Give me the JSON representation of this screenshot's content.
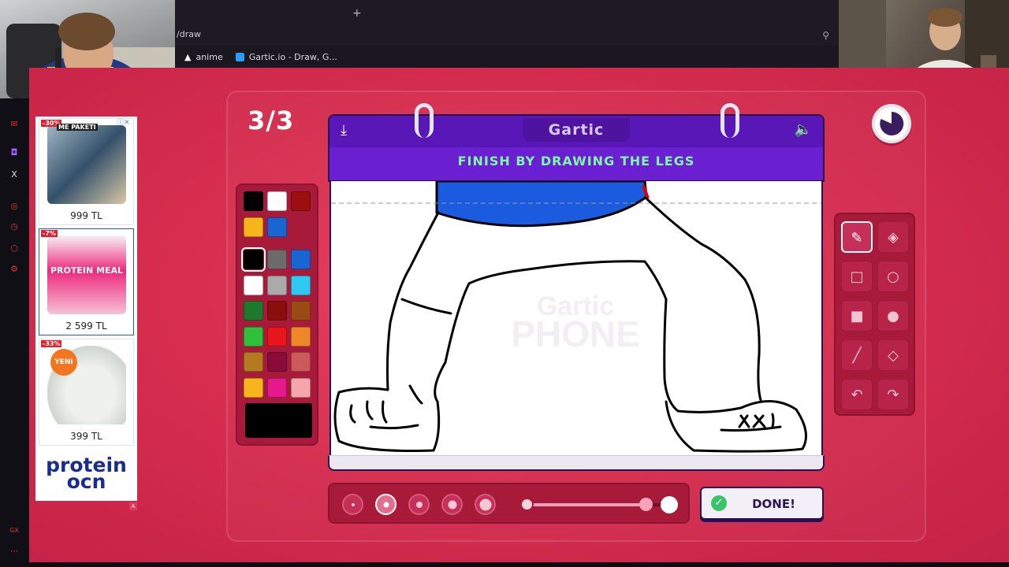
{
  "browser": {
    "new_tab": "+",
    "url_fragment": "/draw",
    "bookmarks": [
      {
        "label": "anime",
        "icon": "anime-icon"
      },
      {
        "label": "Gartic.io - Draw, G...",
        "icon": "gartic-favicon"
      }
    ]
  },
  "game": {
    "round": "3/3",
    "brand": "Gartic",
    "prompt": "FINISH BY DRAWING THE LEGS",
    "done_label": "DONE!",
    "brush_size_selected": 2,
    "opacity_level": 0.83,
    "colors": {
      "background": "#d72e4f",
      "notebook_header": "#6a20d1",
      "prompt_text": "#7ff7a8",
      "selected_color": "#000000"
    },
    "palette_recent": [
      "#000000",
      "#ffffff",
      "#9b0f0f",
      "#f7b51c",
      "#1766d1"
    ],
    "palette": [
      "#000000",
      "#6b6b6b",
      "#1766d1",
      "#ffffff",
      "#aaaaaa",
      "#2ec9f2",
      "#1d7a2c",
      "#8b0e0e",
      "#9a4b14",
      "#2fbf3a",
      "#e8151b",
      "#f0862a",
      "#b47a1f",
      "#8a0b3a",
      "#cc5a5a",
      "#f7b51c",
      "#e41a8c",
      "#f5a6ad"
    ],
    "tools": [
      "pencil-icon",
      "eraser-icon",
      "rectangle-outline-icon",
      "ellipse-outline-icon",
      "rectangle-fill-icon",
      "ellipse-fill-icon",
      "line-icon",
      "fill-bucket-icon",
      "undo-icon",
      "redo-icon"
    ]
  },
  "ads": [
    {
      "badge": "-30%",
      "title": "ME PAKETI",
      "price": "999 TL"
    },
    {
      "badge": "-7%",
      "title": "PROTEIN MEAL",
      "price": "2 599 TL"
    },
    {
      "badge": "-33%",
      "title": "YENI",
      "price": "399 TL"
    }
  ],
  "ad_brand": "protein ocn"
}
